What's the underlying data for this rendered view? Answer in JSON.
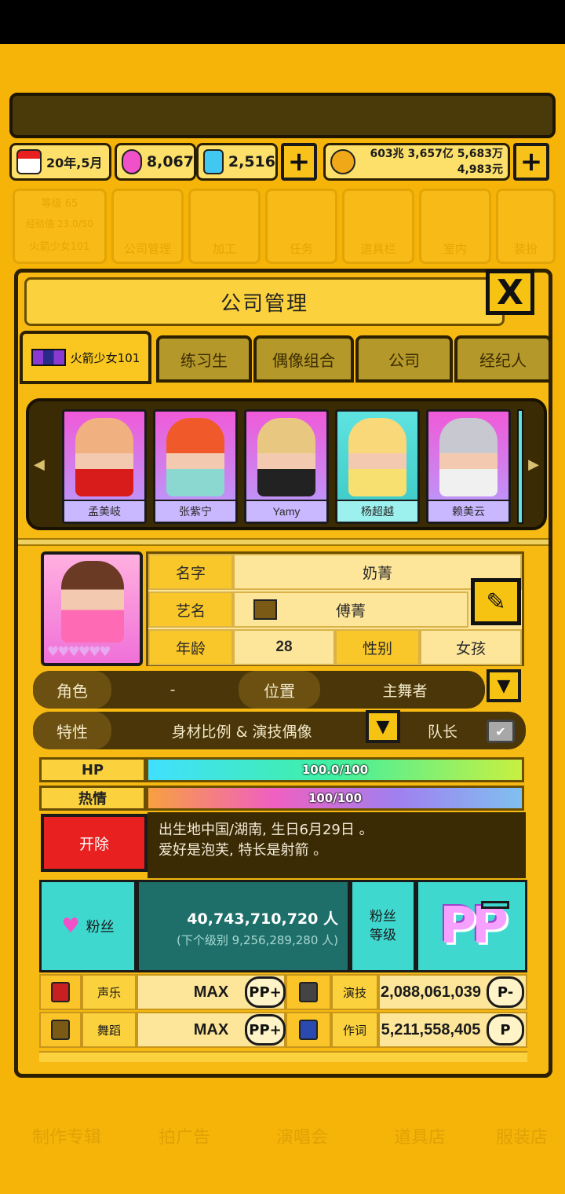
{
  "top": {
    "date": "20年,5月",
    "gems_pink": "8,067",
    "gems_blue": "2,516",
    "money_line1": "603兆 3,657亿 5,683万",
    "money_line2": "4,983元",
    "plus": "+"
  },
  "bg_menu": {
    "level_label": "等级",
    "level_value": "65",
    "exp_label": "经验值",
    "exp_value": "23.0/50",
    "group": "火箭少女101",
    "items": [
      "公司管理",
      "加工",
      "任务",
      "道具栏",
      "室内",
      "装扮"
    ]
  },
  "panel": {
    "title": "公司管理",
    "close": "X",
    "tabs": [
      "火箭少女101",
      "练习生",
      "偶像组合",
      "公司",
      "经纪人"
    ]
  },
  "members": [
    "孟美岐",
    "张紫宁",
    "Yamy",
    "杨超越",
    "赖美云"
  ],
  "profile": {
    "name_label": "名字",
    "name_value": "奶菁",
    "stage_label": "艺名",
    "stage_value": "傅菁",
    "age_label": "年龄",
    "age_value": "28",
    "gender_label": "性别",
    "gender_value": "女孩",
    "hearts": "♥♥♥♥♥♥",
    "edit": "✎"
  },
  "role_row": {
    "role_label": "角色",
    "role_value": "-",
    "position_label": "位置",
    "position_value": "主舞者"
  },
  "trait_row": {
    "trait_label": "特性",
    "trait_value": "身材比例 & 演技偶像",
    "captain_label": "队长"
  },
  "bars": {
    "hp_label": "HP",
    "hp_value": "100.0/100",
    "hp_fraction": 1.0,
    "passion_label": "热情",
    "passion_value": "100/100",
    "passion_fraction": 1.0
  },
  "fire_button": "开除",
  "description": {
    "line1": "出生地中国/湖南, 生日6月29日 。",
    "line2": "爱好是泡芙, 特长是射箭 。"
  },
  "fans": {
    "label": "粉丝",
    "value": "40,743,710,720 人",
    "next": "(下个级别 9,256,289,280 人)",
    "grade_label_1": "粉丝",
    "grade_label_2": "等级",
    "grade": "PP"
  },
  "stats": [
    {
      "left_name": "声乐",
      "left_value": "MAX",
      "left_grade": "PP+",
      "right_name": "演技",
      "right_value": "2,088,061,039",
      "right_grade": "P-"
    },
    {
      "left_name": "舞蹈",
      "left_value": "MAX",
      "left_grade": "PP+",
      "right_name": "作词",
      "right_value": "5,211,558,405",
      "right_grade": "P"
    }
  ],
  "bottom_menu": [
    "制作专辑",
    "拍广告",
    "演唱会",
    "道具店",
    "服装店"
  ],
  "colors": {
    "background": "#f7b408",
    "accent": "#f6c312",
    "teal": "#3fd8cf",
    "fire_red": "#e82020"
  }
}
